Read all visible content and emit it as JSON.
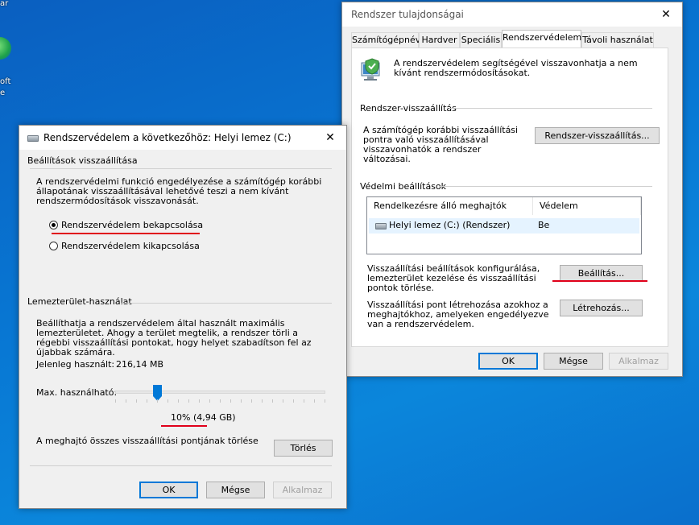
{
  "desktop": {
    "label_top": "ar",
    "label_mid1": "oft",
    "label_mid2": "e"
  },
  "sys_props": {
    "title": "Rendszer tulajdonságai",
    "tabs": [
      "Számítógépnév",
      "Hardver",
      "Speciális",
      "Rendszervédelem",
      "Távoli használat"
    ],
    "intro": "A rendszervédelem segítségével visszavonhatja a nem kívánt rendszermódosításokat.",
    "restore_group": "Rendszer-visszaállítás",
    "restore_text": "A számítógép korábbi visszaállítási pontra való visszaállításával visszavonhatók a rendszer változásai.",
    "restore_button": "Rendszer-visszaállítás...",
    "protection_group": "Védelmi beállítások",
    "col_drives": "Rendelkezésre álló meghajtók",
    "col_protection": "Védelem",
    "drive_name": "Helyi lemez (C:) (Rendszer)",
    "drive_protection": "Be",
    "configure_text": "Visszaállítási beállítások konfigurálása, lemezterület kezelése és visszaállítási pontok törlése.",
    "configure_button": "Beállítás...",
    "create_text": "Visszaállítási pont létrehozása azokhoz a meghajtókhoz, amelyeken engedélyezve van a rendszervédelem.",
    "create_button": "Létrehozás...",
    "ok": "OK",
    "cancel": "Mégse",
    "apply": "Alkalmaz"
  },
  "sp_dialog": {
    "title": "Rendszervédelem a következőhöz: Helyi lemez (C:)",
    "restore_settings_group": "Beállítások visszaállítása",
    "restore_settings_text": "A rendszervédelmi funkció engedélyezése a számítógép korábbi állapotának visszaállításával lehetővé teszi a nem kívánt rendszermódosítások visszavonását.",
    "radio_on": "Rendszervédelem bekapcsolása",
    "radio_off": "Rendszervédelem kikapcsolása",
    "selected": "on",
    "disk_group": "Lemezterület-használat",
    "disk_text": "Beállíthatja a rendszervédelem által használt maximális lemezterületet. Ahogy a terület megtelik, a rendszer törli a régebbi visszaállítási pontokat, hogy helyet szabadítson fel az újabbak számára.",
    "current_label": "Jelenleg használt:",
    "current_value": "216,14 MB",
    "max_label": "Max. használható:",
    "slider_fraction": 0.1,
    "max_value": "10% (4,94 GB)",
    "delete_text": "A meghajtó összes visszaállítási pontjának törlése",
    "delete_button": "Törlés",
    "ok": "OK",
    "cancel": "Mégse",
    "apply": "Alkalmaz"
  },
  "colors": {
    "accent": "#0078d7",
    "annotation": "#e0001a"
  }
}
